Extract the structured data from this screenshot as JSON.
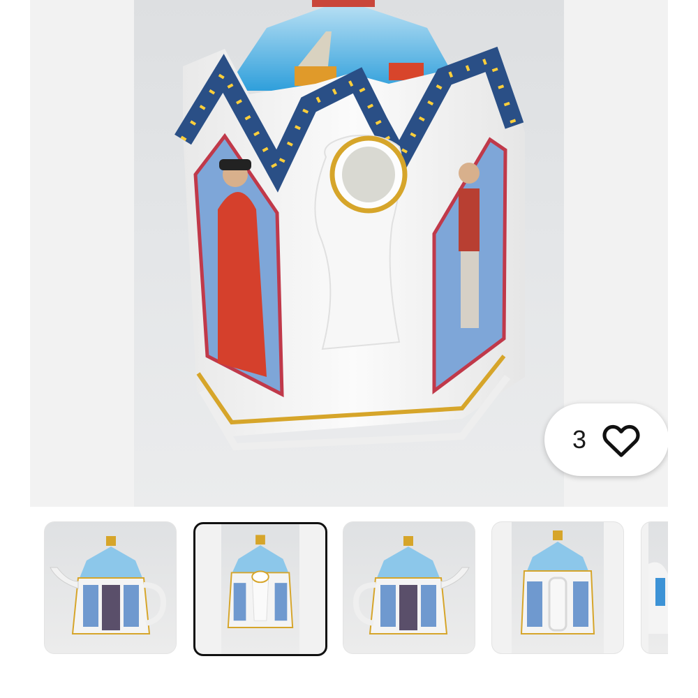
{
  "gallery": {
    "main_image": {
      "icon": "teapot-photo",
      "description_label": ""
    },
    "likes": {
      "count": "3",
      "icon": "heart-icon"
    },
    "thumbnails": [
      {
        "view": "side",
        "selected": false
      },
      {
        "view": "spout-front",
        "selected": true
      },
      {
        "view": "side-reverse",
        "selected": false
      },
      {
        "view": "handle-back",
        "selected": false
      },
      {
        "view": "partial",
        "selected": false
      }
    ]
  },
  "colors": {
    "selected_border": "#111111",
    "background": "#f2f2f2"
  }
}
